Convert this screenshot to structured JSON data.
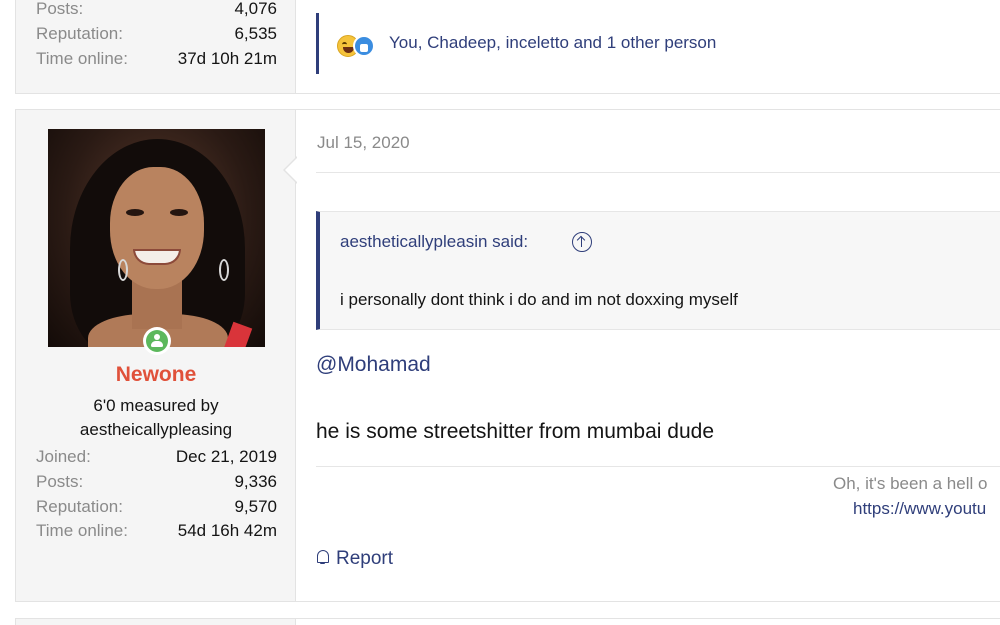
{
  "previous_post": {
    "stats": [
      {
        "label": "Posts:",
        "value": "4,076"
      },
      {
        "label": "Reputation:",
        "value": "6,535"
      },
      {
        "label": "Time online:",
        "value": "37d 10h 21m"
      }
    ],
    "reactions": {
      "icons": [
        "laugh-reaction-icon",
        "like-reaction-icon"
      ],
      "text": "You, Chadeep, inceletto and 1 other person"
    }
  },
  "post": {
    "user": {
      "username": "Newone",
      "title_line1": "6'0 measured by",
      "title_line2": "aestheicallypleasing",
      "stats": [
        {
          "label": "Joined:",
          "value": "Dec 21, 2019"
        },
        {
          "label": "Posts:",
          "value": "9,336"
        },
        {
          "label": "Reputation:",
          "value": "9,570"
        },
        {
          "label": "Time online:",
          "value": "54d 16h 42m"
        }
      ],
      "status_color": "#5cb85c"
    },
    "date": "Jul 15, 2020",
    "quote": {
      "attribution": "aestheticallypleasin said:",
      "text": "i personally dont think i do and im not doxxing myself"
    },
    "mention": "@Mohamad",
    "body": "he is some streetshitter from mumbai dude",
    "signature": {
      "text": "Oh, it's been a hell o",
      "link": "https://www.youtu"
    },
    "report_label": "Report"
  },
  "colors": {
    "accent": "#2f3e7a",
    "username": "#e0513a",
    "muted": "#8a8a8a"
  }
}
